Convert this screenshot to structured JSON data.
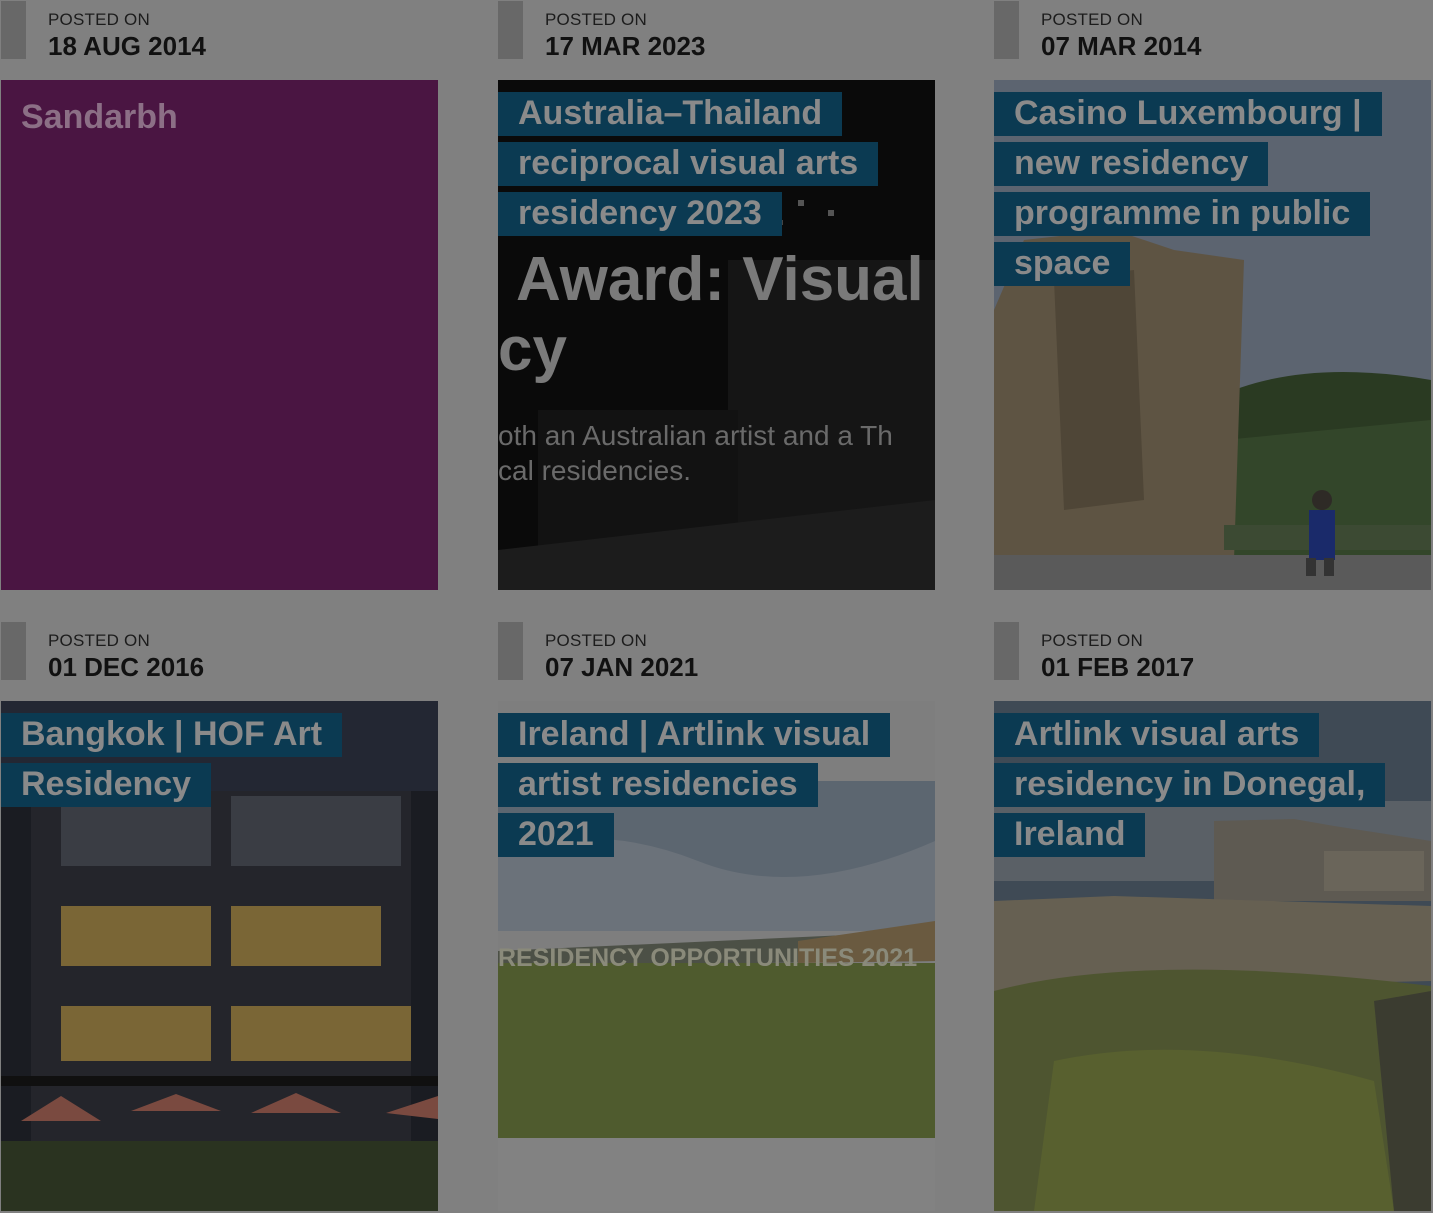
{
  "posts": [
    {
      "posted_label": "POSTED ON",
      "date": "18 AUG 2014",
      "title": "Sandarbh",
      "colors": {
        "thumb_bg": "#4a1542"
      }
    },
    {
      "posted_label": "POSTED ON",
      "date": "17 MAR 2023",
      "title": "Australia–Thailand reciprocal visual arts residency 2023",
      "image_text": {
        "line1": "Award: Visual",
        "line2": "cy",
        "line3": "oth an Australian artist and a Th",
        "line4": "cal residencies."
      }
    },
    {
      "posted_label": "POSTED ON",
      "date": "07 MAR 2014",
      "title": "Casino Luxembourg | new residency programme in public space"
    },
    {
      "posted_label": "POSTED ON",
      "date": "01 DEC 2016",
      "title": "Bangkok | HOF Art Residency"
    },
    {
      "posted_label": "POSTED ON",
      "date": "07 JAN 2021",
      "title": "Ireland | Artlink visual artist residencies 2021",
      "image_text": {
        "line1": "RESIDENCY OPPORTUNITIES 2021"
      }
    },
    {
      "posted_label": "POSTED ON",
      "date": "01 FEB 2017",
      "title": "Artlink visual arts residency in Donegal, Ireland"
    }
  ],
  "colors": {
    "page_bg": "#808080",
    "title_bg": "#0b3a52",
    "date_bar": "#686868"
  }
}
